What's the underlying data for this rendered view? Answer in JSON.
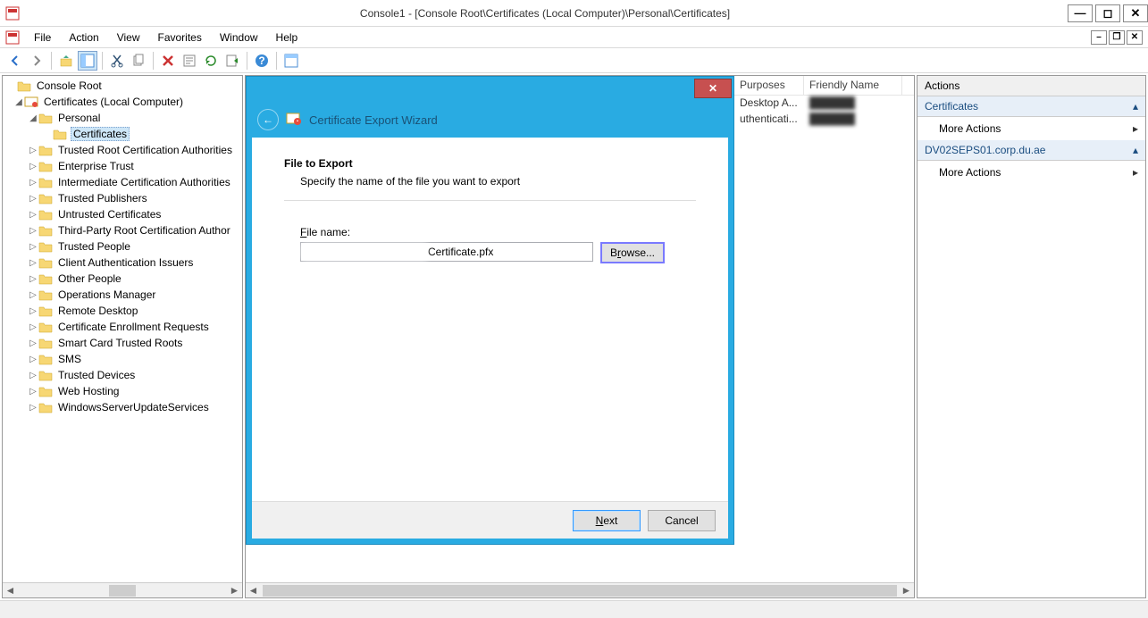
{
  "window": {
    "title": "Console1 - [Console Root\\Certificates (Local Computer)\\Personal\\Certificates]"
  },
  "menu": {
    "file": "File",
    "action": "Action",
    "view": "View",
    "favorites": "Favorites",
    "window": "Window",
    "help": "Help"
  },
  "tree": {
    "root": "Console Root",
    "certs_local": "Certificates (Local Computer)",
    "personal": "Personal",
    "certificates": "Certificates",
    "items": [
      "Trusted Root Certification Authorities",
      "Enterprise Trust",
      "Intermediate Certification Authorities",
      "Trusted Publishers",
      "Untrusted Certificates",
      "Third-Party Root Certification Author",
      "Trusted People",
      "Client Authentication Issuers",
      "Other People",
      "Operations Manager",
      "Remote Desktop",
      "Certificate Enrollment Requests",
      "Smart Card Trusted Roots",
      "SMS",
      "Trusted Devices",
      "Web Hosting",
      "WindowsServerUpdateServices"
    ]
  },
  "list": {
    "col_purposes": "Purposes",
    "col_friendly": "Friendly Name",
    "rows": [
      {
        "purposes": "Desktop A...",
        "friendly": ""
      },
      {
        "purposes": "uthenticati...",
        "friendly": ""
      }
    ]
  },
  "wizard": {
    "title": "Certificate Export Wizard",
    "heading": "File to Export",
    "subtitle": "Specify the name of the file you want to export",
    "file_label": "File name:",
    "file_value": "Certificate.pfx",
    "browse": "Browse...",
    "next": "Next",
    "cancel": "Cancel"
  },
  "actions": {
    "header": "Actions",
    "section1": "Certificates",
    "more1": "More Actions",
    "section2": "DV02SEPS01.corp.du.ae",
    "more2": "More Actions"
  }
}
